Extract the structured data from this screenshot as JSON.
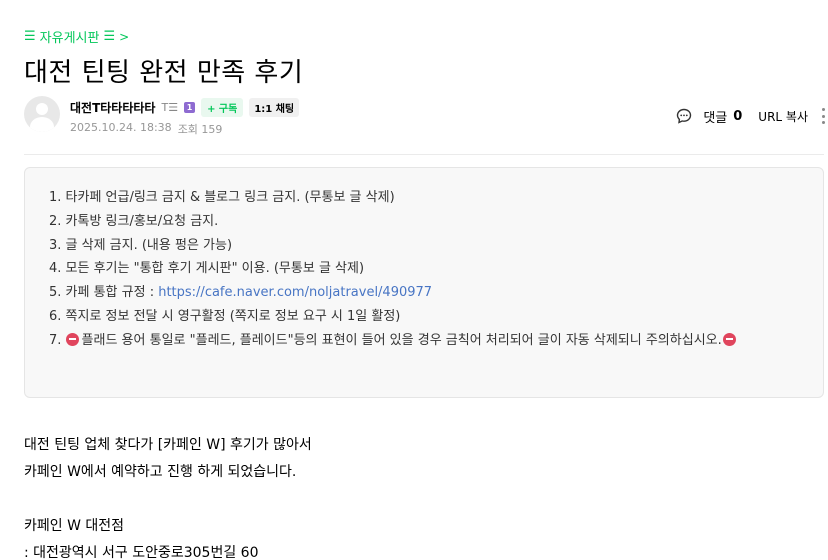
{
  "board": {
    "icon": "menu-icon",
    "label": "자유게시판",
    "chevron": ">"
  },
  "post": {
    "title": "대전 틴팅 완전 만족 후기"
  },
  "author": {
    "name": "대전T타타타타타",
    "grade_icon": "T☰",
    "level": "1",
    "subscribe_label": "+ 구독",
    "chat_label": "1:1 채팅"
  },
  "meta": {
    "date": "2025.10.24. 18:38",
    "views_label": "조회 159"
  },
  "tools": {
    "comment_label": "댓글",
    "comment_count": "0",
    "url_copy_label": "URL 복사"
  },
  "notice": {
    "items": [
      "1. 타카페 언급/링크 금지 & 블로그 링크 금지. (무통보 글 삭제)",
      "2. 카톡방 링크/홍보/요청 금지.",
      "3. 글 삭제 금지. (내용 펑은 가능)",
      "4. 모든 후기는 \"통합 후기 게시판\" 이용. (무통보 글 삭제)",
      "6. 쪽지로 정보 전달 시 영구활정 (쪽지로 정보 요구 시 1일 활정)"
    ],
    "item5_prefix": "5. 카페 통합 규정 : ",
    "item5_link": "https://cafe.naver.com/noljatravel/490977",
    "item7_prefix": "7.",
    "item7_text": "플래드 용어 통일로 \"플레드, 플레이드\"등의 표현이 들어 있을 경우 금칙어 처리되어 글이 자동 삭제되니 주의하십시오."
  },
  "body": {
    "lines": [
      "대전 틴팅 업체 찾다가 [카페인 W] 후기가 많아서",
      "카페인 W에서 예약하고 진행 하게 되었습니다.",
      "카페인 W 대전점",
      ": 대전광역시 서구 도안중로305번길 60"
    ]
  }
}
